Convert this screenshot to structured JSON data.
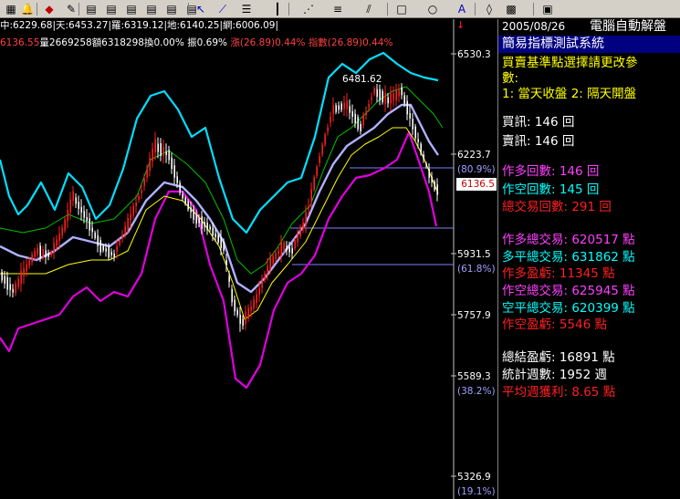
{
  "toolbar": {
    "icons": [
      "grid-icon",
      "bell-icon",
      "hot-icon",
      "pencil-icon",
      "chart-icon",
      "chart-icon",
      "chart-icon",
      "chart-icon",
      "chart-icon",
      "chart-icon",
      "cursor-icon",
      "trendline-icon",
      "levels-icon",
      "vertical-lines-icon",
      "fan-icon",
      "fib-icon",
      "channel-icon",
      "rectangle-icon",
      "circle-icon",
      "text-icon",
      "eraser-icon",
      "palette-icon",
      "save-icon"
    ]
  },
  "stats": {
    "row1": "中:6229.68|天:6453.27|羅:6319.12|地:6140.25|網:6006.09|",
    "row2_price": "6136.55",
    "row2_vol": "量2669258",
    "row2_amt": "額6318298",
    "row2_turn": "換0.00%",
    "row2_amp": "振0.69%",
    "row2_chg": "漲(26.89)0.44%",
    "row2_idx": "指數(26.89)0.44%"
  },
  "axis": {
    "labels": [
      {
        "value": "6530.3"
      },
      {
        "value": "6223.7"
      },
      {
        "value": "(80.9%)"
      },
      {
        "value": "5931.5"
      },
      {
        "value": "(61.8%)"
      },
      {
        "value": "5757.9"
      },
      {
        "value": "5589.3"
      },
      {
        "value": "(38.2%)"
      },
      {
        "value": "5326.9"
      },
      {
        "value": "(19.1%)"
      }
    ],
    "current_price": "6136.5",
    "peak_label": "6481.62"
  },
  "panel": {
    "date": "2005/08/26",
    "app": "電腦自動解盤",
    "title": "簡易指標測試系統",
    "param_text1": "買賣基準點選擇請更改參",
    "param_text2": "數:",
    "param_text3": "1: 當天收盤 2: 隔天開盤",
    "buy_signals": "買訊: 146 回",
    "sell_signals": "賣訊: 146 回",
    "long_count": "作多回數: 146 回",
    "short_count": "作空回數: 145 回",
    "total_count": "總交易回數: 291 回",
    "long_total": "作多總交易: 620517 點",
    "long_close_total": "多平總交易: 631862 點",
    "long_profit": "作多盈虧: 11345 點",
    "short_total": "作空總交易: 625945 點",
    "short_close_total": "空平總交易: 620399 點",
    "short_profit": "作空盈虧: 5546 點",
    "net_profit": "總結盈虧: 16891 點",
    "weeks": "統計週數: 1952 週",
    "avg_weekly": "平均週獲利: 8.65 點"
  },
  "colors": {
    "upper_band": "#00e0ff",
    "lower_band": "#e000e0",
    "mid_band": "#b0b0ff",
    "green_ma": "#00c000",
    "yellow_ma": "#ffff00",
    "candle_up": "#ff2020",
    "candle_down": "#ffffff"
  }
}
